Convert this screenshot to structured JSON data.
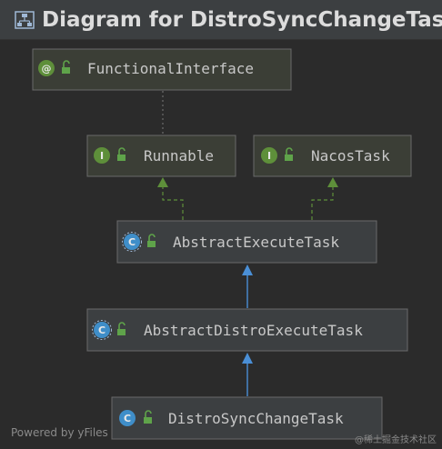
{
  "window": {
    "title": "Diagram for DistroSyncChangeTask"
  },
  "nodes": {
    "functional_interface": {
      "label": "FunctionalInterface",
      "kind": "annotation"
    },
    "runnable": {
      "label": "Runnable",
      "kind": "interface"
    },
    "nacos_task": {
      "label": "NacosTask",
      "kind": "interface"
    },
    "abstract_execute_task": {
      "label": "AbstractExecuteTask",
      "kind": "abstract-class"
    },
    "abstract_distro_execute_task": {
      "label": "AbstractDistroExecuteTask",
      "kind": "abstract-class"
    },
    "distro_sync_change_task": {
      "label": "DistroSyncChangeTask",
      "kind": "class"
    }
  },
  "badges": {
    "annotation": "@",
    "interface": "I",
    "class": "C"
  },
  "edges": [
    {
      "from": "runnable",
      "to": "functional_interface",
      "type": "annotation"
    },
    {
      "from": "abstract_execute_task",
      "to": "runnable",
      "type": "implements"
    },
    {
      "from": "abstract_execute_task",
      "to": "nacos_task",
      "type": "implements"
    },
    {
      "from": "abstract_distro_execute_task",
      "to": "abstract_execute_task",
      "type": "extends"
    },
    {
      "from": "distro_sync_change_task",
      "to": "abstract_distro_execute_task",
      "type": "extends"
    }
  ],
  "colors": {
    "background": "#2b2b2b",
    "node_fill": "#3c3f41",
    "node_border": "#6a6a6a",
    "implements_arrow": "#5e8f3a",
    "extends_arrow": "#4a8fd6",
    "interface_badge": "#5e8f3a",
    "class_badge": "#3f8ec9"
  },
  "footer": {
    "powered_by": "Powered by yFiles",
    "watermark": "@稀土掘金技术社区"
  }
}
